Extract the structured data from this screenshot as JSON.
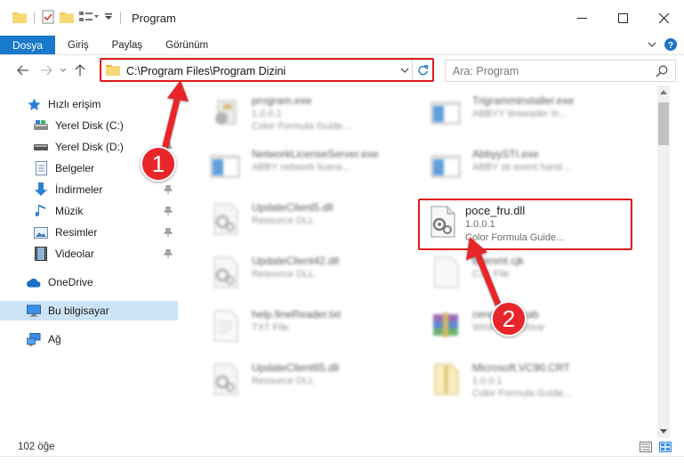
{
  "window": {
    "title": "Program"
  },
  "ribbon": {
    "tabs": [
      "Dosya",
      "Giriş",
      "Paylaş",
      "Görünüm"
    ]
  },
  "navigation": {
    "address": "C:\\Program Files\\Program Dizini",
    "search_placeholder": "Ara: Program"
  },
  "sidebar": {
    "items": [
      {
        "label": "Hızlı erişim",
        "icon": "star-icon"
      },
      {
        "label": "Yerel Disk (C:)",
        "icon": "drive-icon"
      },
      {
        "label": "Yerel Disk (D:)",
        "icon": "drive-icon"
      },
      {
        "label": "Belgeler",
        "icon": "documents-icon"
      },
      {
        "label": "İndirmeler",
        "icon": "downloads-icon"
      },
      {
        "label": "Müzik",
        "icon": "music-icon"
      },
      {
        "label": "Resimler",
        "icon": "pictures-icon"
      },
      {
        "label": "Videolar",
        "icon": "videos-icon"
      },
      {
        "label": "OneDrive",
        "icon": "cloud-icon"
      },
      {
        "label": "Bu bilgisayar",
        "icon": "computer-icon"
      },
      {
        "label": "Ağ",
        "icon": "network-icon"
      }
    ],
    "selected": "Bu bilgisayar"
  },
  "files": [
    {
      "name": "program.exe",
      "line1": "1.0.0.1",
      "line2": "Color Formula Guide...",
      "icon": "exe-icon"
    },
    {
      "name": "Trigramminstaller.exe",
      "line1": "ABBYY Itrewader In...",
      "line2": "",
      "icon": "app-window-icon"
    },
    {
      "name": "NetworkLicenseServer.exe",
      "line1": "ABBY network licens...",
      "line2": "",
      "icon": "app-window-icon"
    },
    {
      "name": "AbbyySTI.exe",
      "line1": "ABBY sti event hand...",
      "line2": "",
      "icon": "app-window-icon"
    },
    {
      "name": "UpdateClient5.dll",
      "line1": "Resource DLL",
      "line2": "",
      "icon": "dll-icon"
    },
    {
      "name": "poce_fru.dll",
      "line1": "1.0.0.1",
      "line2": "Color Formula Guide...",
      "icon": "dll-icon"
    },
    {
      "name": "UpdateClient42.dll",
      "line1": "Resource DLL",
      "line2": "",
      "icon": "dll-icon"
    },
    {
      "name": "Bilenmt.cjk",
      "line1": "CJK File",
      "line2": "",
      "icon": "blank-file-icon"
    },
    {
      "name": "help.fineReader.txt",
      "line1": "TXT File",
      "line2": "",
      "icon": "text-file-icon"
    },
    {
      "name": "cereabuis.cab",
      "line1": "WinRAR archive",
      "line2": "",
      "icon": "archive-icon"
    },
    {
      "name": "UpdateClient65.dll",
      "line1": "Resource DLL",
      "line2": "",
      "icon": "dll-icon"
    },
    {
      "name": "Microsoft.VC90.CRT",
      "line1": "1.0.0.1",
      "line2": "Color Formula Guide...",
      "icon": "folder-zip-icon"
    }
  ],
  "status": {
    "item_count": "102 öğe"
  },
  "callouts": [
    "1",
    "2"
  ],
  "colors": {
    "accent": "#1979ca",
    "highlight": "#e01919",
    "callout": "#e8262a",
    "selected_bg": "#cce4f7"
  }
}
